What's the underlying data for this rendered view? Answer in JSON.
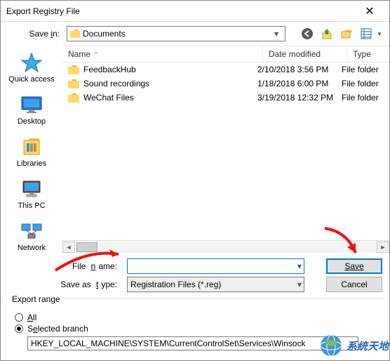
{
  "window": {
    "title": "Export Registry File"
  },
  "savein": {
    "label": "Save in:",
    "current": "Documents"
  },
  "toolbar_icons": {
    "back": "back-icon",
    "up": "up-one-level-icon",
    "newfolder": "new-folder-icon",
    "viewmenu": "view-menu-icon"
  },
  "columns": {
    "name": "Name",
    "date": "Date modified",
    "type": "Type"
  },
  "files": [
    {
      "name": "FeedbackHub",
      "date": "2/10/2018 3:56 PM",
      "type": "File folder"
    },
    {
      "name": "Sound recordings",
      "date": "1/18/2018 6:00 PM",
      "type": "File folder"
    },
    {
      "name": "WeChat Files",
      "date": "3/19/2018 12:32 PM",
      "type": "File folder"
    }
  ],
  "places": [
    {
      "id": "quick-access",
      "label": "Quick access"
    },
    {
      "id": "desktop",
      "label": "Desktop"
    },
    {
      "id": "libraries",
      "label": "Libraries"
    },
    {
      "id": "this-pc",
      "label": "This PC"
    },
    {
      "id": "network",
      "label": "Network"
    }
  ],
  "inputs": {
    "filename_label": "File name:",
    "filename_underline": "n",
    "filename_value": "",
    "saveastype_label": "Save as type:",
    "saveastype_underline": "t",
    "saveastype_value": "Registration Files (*.reg)"
  },
  "buttons": {
    "save": "Save",
    "cancel": "Cancel"
  },
  "export_range": {
    "legend": "Export range",
    "all_label": "All",
    "selected_label": "Selected branch",
    "selected_value": "HKEY_LOCAL_MACHINE\\SYSTEM\\CurrentControlSet\\Services\\Winsock",
    "selected_checked": true
  },
  "watermark": {
    "text": "系统天地"
  }
}
